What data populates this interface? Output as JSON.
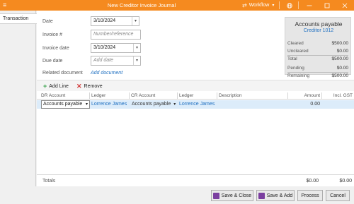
{
  "window": {
    "title": "New Creditor Invoice Journal",
    "menu_glyph": "≡",
    "workflow_label": "Workflow",
    "workflow_caret": "▾"
  },
  "tabs": [
    {
      "label": "Transaction"
    }
  ],
  "form": {
    "date_label": "Date",
    "date_value": "3/10/2024",
    "invoice_label": "Invoice #",
    "invoice_placeholder": "Number/reference",
    "invoice_date_label": "Invoice date",
    "invoice_date_value": "3/10/2024",
    "due_date_label": "Due date",
    "due_date_placeholder": "Add date",
    "related_label": "Related document",
    "related_link": "Add document"
  },
  "summary": {
    "title": "Accounts payable",
    "creditor": "Creditor 1012",
    "rows": [
      {
        "label": "Cleared",
        "value": "$500.00"
      },
      {
        "label": "Uncleared",
        "value": "$0.00"
      },
      {
        "label": "Total",
        "value": "$500.00"
      },
      {
        "label": "Pending",
        "value": "$0.00"
      },
      {
        "label": "Remaining",
        "value": "$500.00"
      }
    ]
  },
  "toolbar": {
    "add_line": "Add Line",
    "remove": "Remove"
  },
  "grid": {
    "columns": [
      "DR Account",
      "Ledger",
      "CR Account",
      "Ledger",
      "Description",
      "Amount",
      "Incl. GST"
    ],
    "rows": [
      {
        "dr_account": "Accounts payable",
        "dr_ledger": "Lorrence James",
        "cr_account": "Accounts payable",
        "cr_ledger": "Lorrence James",
        "description": "",
        "amount": "0.00",
        "incl_gst": ""
      }
    ]
  },
  "totals": {
    "label": "Totals",
    "amount": "$0.00",
    "incl_gst": "$0.00"
  },
  "footer": {
    "save_close": "Save & Close",
    "save_add": "Save & Add",
    "process": "Process",
    "cancel": "Cancel"
  },
  "colors": {
    "titlebar": "#f58a1f",
    "link": "#1e6fc0",
    "selected_row": "#dcecfa",
    "save_icon": "#7b3fa0"
  }
}
